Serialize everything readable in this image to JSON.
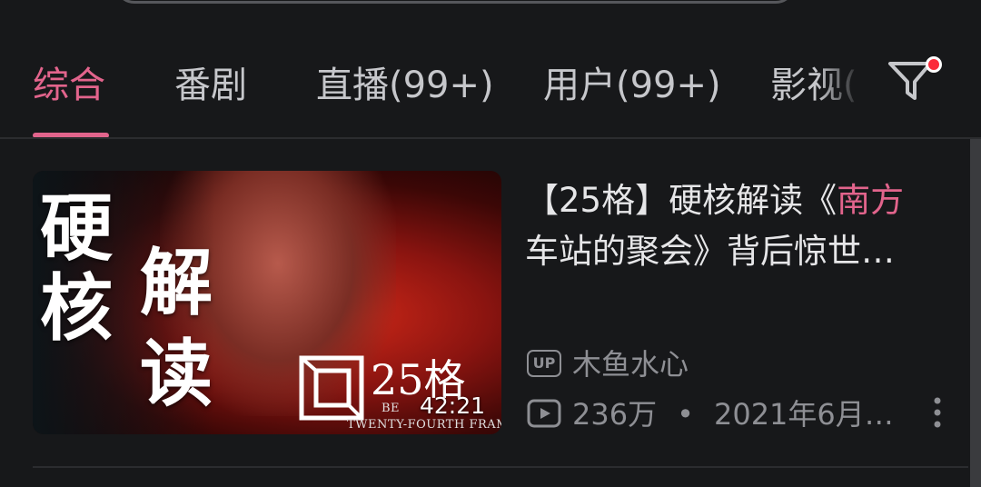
{
  "tabs": [
    {
      "label": "综合",
      "active": true
    },
    {
      "label": "番剧"
    },
    {
      "label": "直播(99+)"
    },
    {
      "label": "用户(99+)"
    },
    {
      "label": "影视("
    }
  ],
  "filter": {
    "icon": "filter-icon",
    "has_notification_dot": true
  },
  "colors": {
    "accent": "#e2648c",
    "background": "#17181a",
    "meta": "#8e8f94"
  },
  "result": {
    "thumbnail": {
      "title_chars": [
        "硬",
        "核",
        "解",
        "读"
      ],
      "logo_text": "25格",
      "logo_subtext_1": "BE",
      "logo_subtext_2": "TWENTY-FOURTH FRAME",
      "duration": "42:21"
    },
    "title_line1_pre": "【25格】硬核解读《",
    "title_line1_hl": "南方",
    "title_line2": "车站的聚会》背后惊世…",
    "up_badge": "UP",
    "uploader": "木鱼水心",
    "views": "236万",
    "separator": "•",
    "date": "2021年6月…"
  }
}
